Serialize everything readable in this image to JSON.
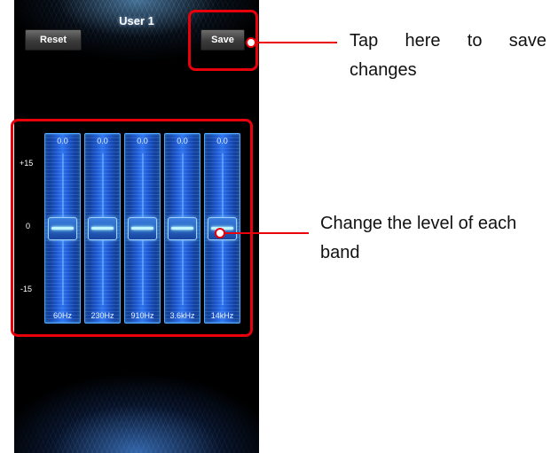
{
  "screen": {
    "preset_title": "User 1",
    "reset_label": "Reset",
    "save_label": "Save"
  },
  "equalizer": {
    "scale": {
      "max": "+15",
      "mid": "0",
      "min": "-15"
    },
    "bands": [
      {
        "value": "0.0",
        "freq": "60Hz",
        "level_db": 0
      },
      {
        "value": "0.0",
        "freq": "230Hz",
        "level_db": 0
      },
      {
        "value": "0.0",
        "freq": "910Hz",
        "level_db": 0
      },
      {
        "value": "0.0",
        "freq": "3.6kHz",
        "level_db": 0
      },
      {
        "value": "0.0",
        "freq": "14kHz",
        "level_db": 0
      }
    ]
  },
  "annotations": {
    "save_callout": "Tap here to save changes",
    "bands_callout": "Change the level of each band",
    "highlight_color": "#e8000b"
  }
}
